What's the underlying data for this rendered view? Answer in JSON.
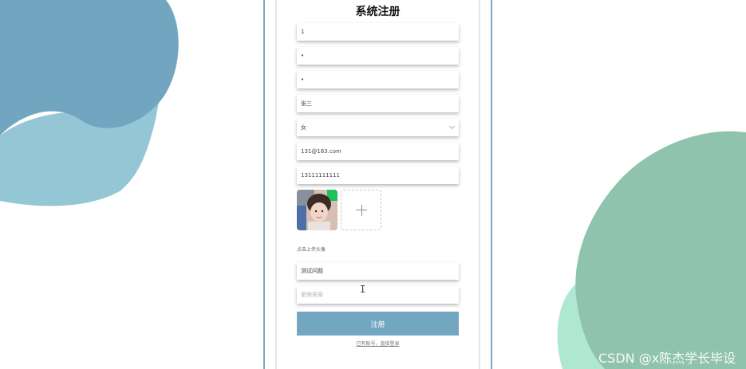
{
  "form": {
    "title": "系统注册",
    "username_value": "1",
    "password_value": "•",
    "confirm_password_value": "•",
    "real_name_value": "张三",
    "gender_value": "女",
    "email_value": "131@163.com",
    "phone_value": "13111111111",
    "upload_hint": "点击上传头像",
    "security_question_value": "测试问题",
    "security_answer_placeholder": "密保答案",
    "register_label": "注册",
    "login_link_label": "已有账号，直接登录"
  },
  "watermark": "CSDN @x陈杰学长毕设",
  "colors": {
    "primary_button": "#73a7c1",
    "blob_blue": "#72a6c0",
    "blob_light_blue": "#94c6d5",
    "blob_green": "#8fc3ad",
    "blob_mint": "#aee7d2"
  }
}
